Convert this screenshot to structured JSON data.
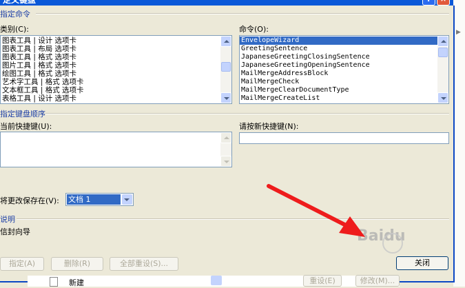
{
  "dialog": {
    "title": "定义键盘",
    "specify_command_label": "指定命令",
    "categories_label": "类别(C):",
    "categories": [
      "图表工具 | 设计 选项卡",
      "图表工具 | 布局 选项卡",
      "图表工具 | 格式 选项卡",
      "图片工具 | 格式 选项卡",
      "绘图工具 | 格式 选项卡",
      "艺术字工具 | 格式 选项卡",
      "文本框工具 | 格式 选项卡",
      "表格工具 | 设计 选项卡"
    ],
    "commands_label": "命令(O):",
    "commands": [
      "EnvelopeWizard",
      "GreetingSentence",
      "JapaneseGreetingClosingSentence",
      "JapaneseGreetingOpeningSentence",
      "MailMergeAddressBlock",
      "MailMergeCheck",
      "MailMergeClearDocumentType",
      "MailMergeCreateList"
    ],
    "selected_command_index": 0,
    "key_sequence_label": "指定键盘顺序",
    "current_keys_label": "当前快捷键(U):",
    "new_shortcut_label": "请按新快捷键(N):",
    "new_shortcut_value": "",
    "save_changes_label": "将更改保存在(V):",
    "save_changes_value": "文档 1",
    "description_label": "说明",
    "description_text": "信封向导",
    "assign_button": "指定(A)",
    "remove_button": "删除(R)",
    "reset_all_button": "全部重设(S)...",
    "close_button": "关闭"
  },
  "underlying": {
    "item_label": "新建",
    "reset_button": "重设(E)",
    "modify_button": "修改(M)..."
  },
  "watermark": "Baidu",
  "colors": {
    "titlebar": "#0a58d8",
    "selection": "#316ac5",
    "arrow": "#ee1c1c",
    "group_label": "#1c3fa6"
  },
  "icons": [
    "help-icon",
    "close-icon",
    "scroll-up-icon",
    "scroll-down-icon",
    "dropdown-arrow-icon",
    "arrow-annotation-icon",
    "baidu-paw-icon"
  ]
}
